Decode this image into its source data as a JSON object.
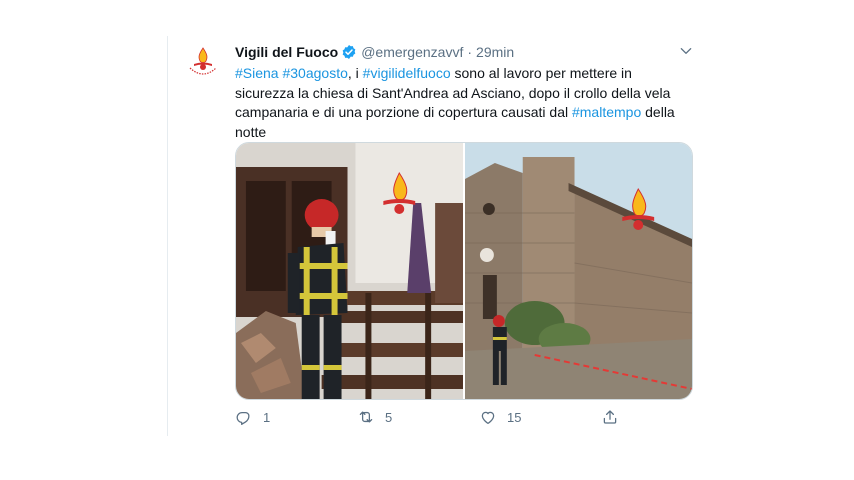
{
  "tweet": {
    "author_name": "Vigili del Fuoco",
    "handle": "@emergenzavvf",
    "separator": "·",
    "time": "29min",
    "text": [
      {
        "t": "#Siena",
        "tag": true
      },
      {
        "t": " ",
        "tag": false
      },
      {
        "t": "#30agosto",
        "tag": true
      },
      {
        "t": ", i ",
        "tag": false
      },
      {
        "t": "#vigilidelfuoco",
        "tag": true
      },
      {
        "t": " sono al lavoro per mettere in sicurezza la chiesa di Sant'Andrea ad Asciano, dopo il crollo della vela campanaria e di una porzione di copertura causati dal ",
        "tag": false
      },
      {
        "t": "#maltempo",
        "tag": true
      },
      {
        "t": " della notte",
        "tag": false
      }
    ],
    "media": {
      "watermark_text": "Vigili del Fuoco",
      "photo_left_desc": "firefighter inside damaged church",
      "photo_right_desc": "stone church exterior"
    },
    "actions": {
      "reply_count": "1",
      "retweet_count": "5",
      "like_count": "15"
    },
    "colors": {
      "link": "#1b95e0",
      "verified": "#1da1f2",
      "muted": "#5b7083",
      "brand_red": "#d32f2f",
      "brand_yellow": "#f9b81b"
    },
    "icons": [
      "verified-badge-icon",
      "chevron-down-icon",
      "reply-icon",
      "retweet-icon",
      "like-icon",
      "share-icon"
    ]
  }
}
